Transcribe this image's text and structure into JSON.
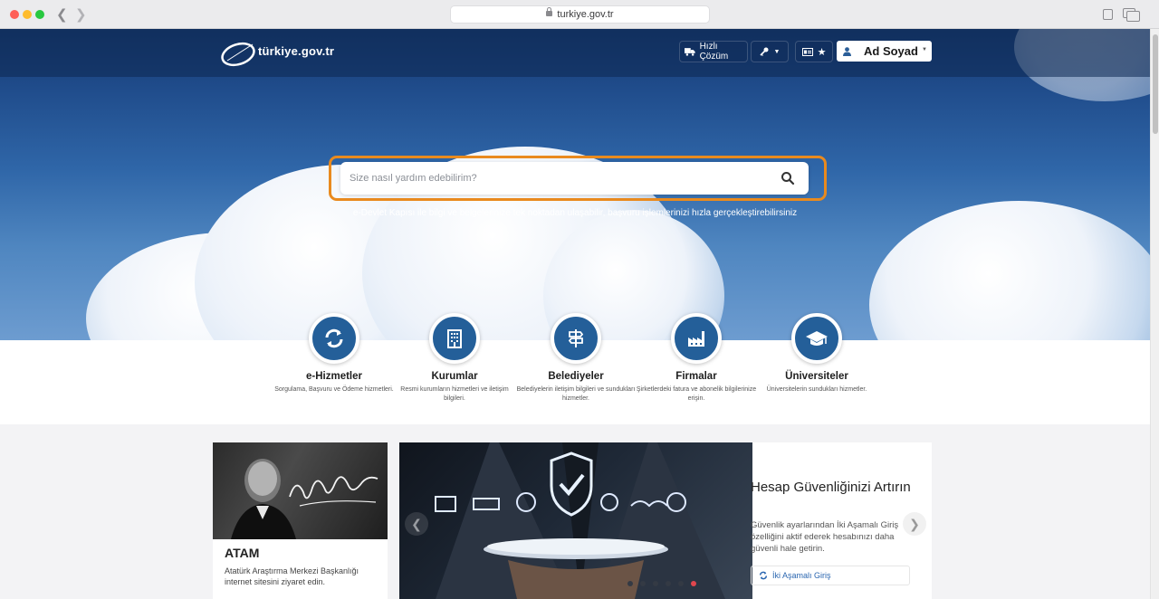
{
  "browser": {
    "url": "turkiye.gov.tr"
  },
  "header": {
    "logo_text": "türkiye.gov.tr",
    "quick_solution_label": "Hızlı Çözüm",
    "user_name": "Ad Soyad"
  },
  "hero": {
    "search_placeholder": "Size nasıl yardım edebilirim?",
    "tagline": "e-Devlet Kapısı ile bilgi ve belgelerinize tek noktadan ulaşabilir, başvuru işlemlerinizi hızla gerçekleştirebilirsiniz"
  },
  "categories": [
    {
      "title": "e-Hizmetler",
      "desc": "Sorgulama, Başvuru ve Ödeme hizmetleri.",
      "icon": "refresh-icon"
    },
    {
      "title": "Kurumlar",
      "desc": "Resmi kurumların hizmetleri ve iletişim bilgileri.",
      "icon": "building-icon"
    },
    {
      "title": "Belediyeler",
      "desc": "Belediyelerin iletişim bilgileri ve sundukları hizmetler.",
      "icon": "signpost-icon"
    },
    {
      "title": "Firmalar",
      "desc": "Şirketlerdeki fatura ve abonelik bilgilerinize erişin.",
      "icon": "factory-icon"
    },
    {
      "title": "Üniversiteler",
      "desc": "Üniversitelerin sundukları hizmetler.",
      "icon": "graduation-cap-icon"
    }
  ],
  "atam_card": {
    "title": "ATAM",
    "text": "Atatürk Araştırma Merkezi Başkanlığı internet sitesini ziyaret edin."
  },
  "slider": {
    "title": "Hesap Güvenliğinizi Artırın",
    "text": "Güvenlik ayarlarından İki Aşamalı Giriş özelliğini aktif ederek hesabınızı daha güvenli hale getirin.",
    "link_label": "İki Aşamalı Giriş",
    "dot_count": 6,
    "active_dot": 6
  },
  "colors": {
    "accent_orange": "#e98a1e",
    "brand_blue": "#245f99",
    "active_dot": "#e0464e"
  }
}
